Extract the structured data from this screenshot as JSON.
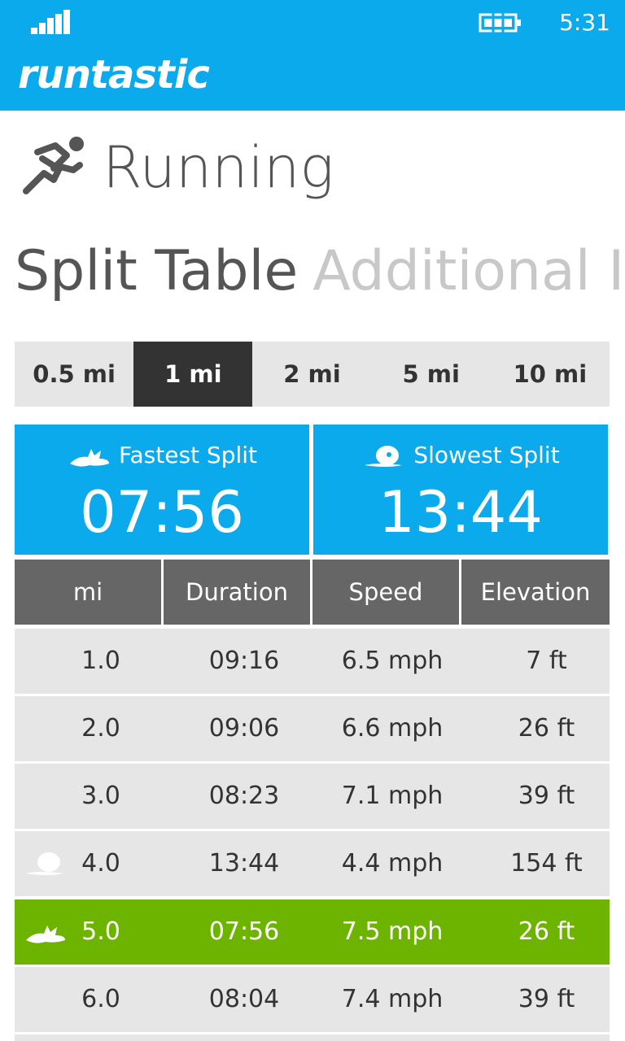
{
  "status_bar": {
    "time": "5:31",
    "icons": [
      "signal-icon",
      "battery-charging-icon"
    ]
  },
  "app": {
    "logo_text": "runtastic",
    "brand_color": "#0aaaec"
  },
  "activity": {
    "title": "Running",
    "icon": "runner-icon"
  },
  "pivot": {
    "active": "Split Table",
    "next": "Additional In"
  },
  "intervals": {
    "options": [
      "0.5 mi",
      "1 mi",
      "2 mi",
      "5 mi",
      "10 mi"
    ],
    "selected": "1 mi"
  },
  "summary": {
    "fastest_label": "Fastest Split",
    "fastest_value": "07:56",
    "slowest_label": "Slowest Split",
    "slowest_value": "13:44"
  },
  "table": {
    "headers": [
      "mi",
      "Duration",
      "Speed",
      "Elevation"
    ],
    "rows": [
      {
        "mi": "1.0",
        "duration": "09:16",
        "speed": "6.5 mph",
        "elevation": "7 ft"
      },
      {
        "mi": "2.0",
        "duration": "09:06",
        "speed": "6.6 mph",
        "elevation": "26 ft"
      },
      {
        "mi": "3.0",
        "duration": "08:23",
        "speed": "7.1 mph",
        "elevation": "39 ft"
      },
      {
        "mi": "4.0",
        "duration": "13:44",
        "speed": "4.4 mph",
        "elevation": "154 ft",
        "marker": "slowest"
      },
      {
        "mi": "5.0",
        "duration": "07:56",
        "speed": "7.5 mph",
        "elevation": "26 ft",
        "marker": "fastest"
      },
      {
        "mi": "6.0",
        "duration": "08:04",
        "speed": "7.4 mph",
        "elevation": "39 ft"
      }
    ]
  },
  "colors": {
    "highlight_green": "#6db400",
    "header_gray": "#666666",
    "row_gray": "#e6e6e6"
  }
}
